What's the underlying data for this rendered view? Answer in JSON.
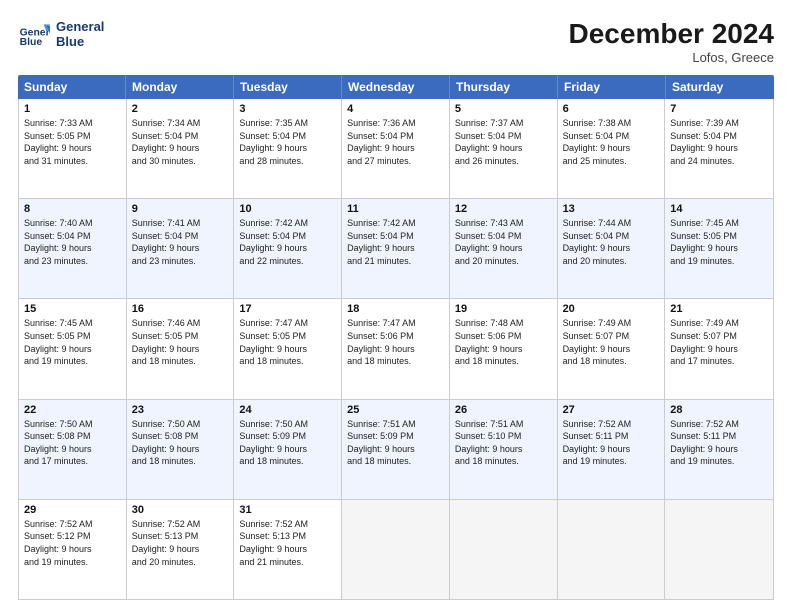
{
  "header": {
    "logo_line1": "General",
    "logo_line2": "Blue",
    "title": "December 2024",
    "subtitle": "Lofos, Greece"
  },
  "weekdays": [
    "Sunday",
    "Monday",
    "Tuesday",
    "Wednesday",
    "Thursday",
    "Friday",
    "Saturday"
  ],
  "weeks": [
    [
      {
        "day": "1",
        "info": "Sunrise: 7:33 AM\nSunset: 5:05 PM\nDaylight: 9 hours\nand 31 minutes."
      },
      {
        "day": "2",
        "info": "Sunrise: 7:34 AM\nSunset: 5:04 PM\nDaylight: 9 hours\nand 30 minutes."
      },
      {
        "day": "3",
        "info": "Sunrise: 7:35 AM\nSunset: 5:04 PM\nDaylight: 9 hours\nand 28 minutes."
      },
      {
        "day": "4",
        "info": "Sunrise: 7:36 AM\nSunset: 5:04 PM\nDaylight: 9 hours\nand 27 minutes."
      },
      {
        "day": "5",
        "info": "Sunrise: 7:37 AM\nSunset: 5:04 PM\nDaylight: 9 hours\nand 26 minutes."
      },
      {
        "day": "6",
        "info": "Sunrise: 7:38 AM\nSunset: 5:04 PM\nDaylight: 9 hours\nand 25 minutes."
      },
      {
        "day": "7",
        "info": "Sunrise: 7:39 AM\nSunset: 5:04 PM\nDaylight: 9 hours\nand 24 minutes."
      }
    ],
    [
      {
        "day": "8",
        "info": "Sunrise: 7:40 AM\nSunset: 5:04 PM\nDaylight: 9 hours\nand 23 minutes."
      },
      {
        "day": "9",
        "info": "Sunrise: 7:41 AM\nSunset: 5:04 PM\nDaylight: 9 hours\nand 23 minutes."
      },
      {
        "day": "10",
        "info": "Sunrise: 7:42 AM\nSunset: 5:04 PM\nDaylight: 9 hours\nand 22 minutes."
      },
      {
        "day": "11",
        "info": "Sunrise: 7:42 AM\nSunset: 5:04 PM\nDaylight: 9 hours\nand 21 minutes."
      },
      {
        "day": "12",
        "info": "Sunrise: 7:43 AM\nSunset: 5:04 PM\nDaylight: 9 hours\nand 20 minutes."
      },
      {
        "day": "13",
        "info": "Sunrise: 7:44 AM\nSunset: 5:04 PM\nDaylight: 9 hours\nand 20 minutes."
      },
      {
        "day": "14",
        "info": "Sunrise: 7:45 AM\nSunset: 5:05 PM\nDaylight: 9 hours\nand 19 minutes."
      }
    ],
    [
      {
        "day": "15",
        "info": "Sunrise: 7:45 AM\nSunset: 5:05 PM\nDaylight: 9 hours\nand 19 minutes."
      },
      {
        "day": "16",
        "info": "Sunrise: 7:46 AM\nSunset: 5:05 PM\nDaylight: 9 hours\nand 18 minutes."
      },
      {
        "day": "17",
        "info": "Sunrise: 7:47 AM\nSunset: 5:05 PM\nDaylight: 9 hours\nand 18 minutes."
      },
      {
        "day": "18",
        "info": "Sunrise: 7:47 AM\nSunset: 5:06 PM\nDaylight: 9 hours\nand 18 minutes."
      },
      {
        "day": "19",
        "info": "Sunrise: 7:48 AM\nSunset: 5:06 PM\nDaylight: 9 hours\nand 18 minutes."
      },
      {
        "day": "20",
        "info": "Sunrise: 7:49 AM\nSunset: 5:07 PM\nDaylight: 9 hours\nand 18 minutes."
      },
      {
        "day": "21",
        "info": "Sunrise: 7:49 AM\nSunset: 5:07 PM\nDaylight: 9 hours\nand 17 minutes."
      }
    ],
    [
      {
        "day": "22",
        "info": "Sunrise: 7:50 AM\nSunset: 5:08 PM\nDaylight: 9 hours\nand 17 minutes."
      },
      {
        "day": "23",
        "info": "Sunrise: 7:50 AM\nSunset: 5:08 PM\nDaylight: 9 hours\nand 18 minutes."
      },
      {
        "day": "24",
        "info": "Sunrise: 7:50 AM\nSunset: 5:09 PM\nDaylight: 9 hours\nand 18 minutes."
      },
      {
        "day": "25",
        "info": "Sunrise: 7:51 AM\nSunset: 5:09 PM\nDaylight: 9 hours\nand 18 minutes."
      },
      {
        "day": "26",
        "info": "Sunrise: 7:51 AM\nSunset: 5:10 PM\nDaylight: 9 hours\nand 18 minutes."
      },
      {
        "day": "27",
        "info": "Sunrise: 7:52 AM\nSunset: 5:11 PM\nDaylight: 9 hours\nand 19 minutes."
      },
      {
        "day": "28",
        "info": "Sunrise: 7:52 AM\nSunset: 5:11 PM\nDaylight: 9 hours\nand 19 minutes."
      }
    ],
    [
      {
        "day": "29",
        "info": "Sunrise: 7:52 AM\nSunset: 5:12 PM\nDaylight: 9 hours\nand 19 minutes."
      },
      {
        "day": "30",
        "info": "Sunrise: 7:52 AM\nSunset: 5:13 PM\nDaylight: 9 hours\nand 20 minutes."
      },
      {
        "day": "31",
        "info": "Sunrise: 7:52 AM\nSunset: 5:13 PM\nDaylight: 9 hours\nand 21 minutes."
      },
      {
        "day": "",
        "info": ""
      },
      {
        "day": "",
        "info": ""
      },
      {
        "day": "",
        "info": ""
      },
      {
        "day": "",
        "info": ""
      }
    ]
  ]
}
